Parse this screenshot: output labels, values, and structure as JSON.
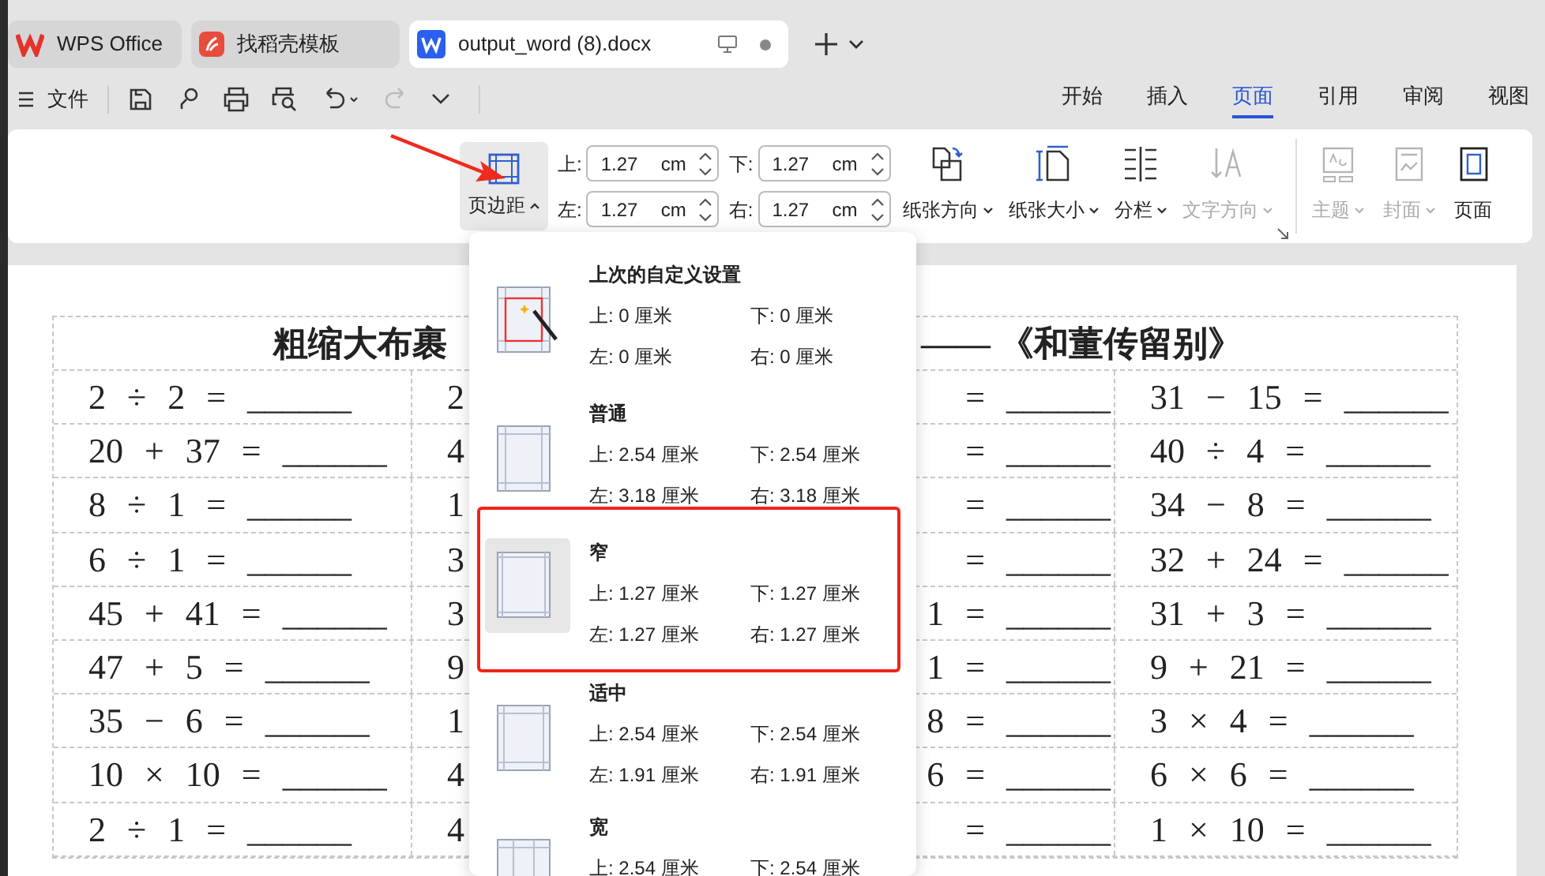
{
  "tabs": [
    {
      "label": "WPS Office",
      "kind": "wps",
      "selected": false
    },
    {
      "label": "找稻壳模板",
      "kind": "docer",
      "selected": false
    },
    {
      "label": "output_word (8).docx",
      "kind": "writer",
      "selected": true
    }
  ],
  "quick_toolbar": {
    "file_label": "文件"
  },
  "ribbon_tabs": [
    {
      "label": "开始",
      "selected": false
    },
    {
      "label": "插入",
      "selected": false
    },
    {
      "label": "页面",
      "selected": true
    },
    {
      "label": "引用",
      "selected": false
    },
    {
      "label": "审阅",
      "selected": false
    },
    {
      "label": "视图",
      "selected": false
    }
  ],
  "ribbon": {
    "margin_button": "页边距",
    "margin_fields": [
      {
        "label": "上:",
        "value": "1.27",
        "unit": "cm"
      },
      {
        "label": "下:",
        "value": "1.27",
        "unit": "cm"
      },
      {
        "label": "左:",
        "value": "1.27",
        "unit": "cm"
      },
      {
        "label": "右:",
        "value": "1.27",
        "unit": "cm"
      }
    ],
    "tools": [
      {
        "label": "纸张方向",
        "kind": "orientation",
        "disabled": false
      },
      {
        "label": "纸张大小",
        "kind": "size",
        "disabled": false
      },
      {
        "label": "分栏",
        "kind": "columns",
        "disabled": false
      },
      {
        "label": "文字方向",
        "kind": "textdir",
        "disabled": true
      }
    ],
    "tools_2": [
      {
        "label": "主题",
        "kind": "theme",
        "disabled": true
      },
      {
        "label": "封面",
        "kind": "cover",
        "disabled": true
      },
      {
        "label": "页面",
        "kind": "page",
        "disabled": false
      }
    ]
  },
  "margin_menu": {
    "presets": [
      {
        "title": "上次的自定义设置",
        "kind": "custom",
        "selected": false,
        "values": [
          "上: 0 厘米",
          "下: 0 厘米",
          "左: 0 厘米",
          "右: 0 厘米"
        ]
      },
      {
        "title": "普通",
        "kind": "normal",
        "selected": false,
        "values": [
          "上: 2.54 厘米",
          "下: 2.54 厘米",
          "左: 3.18 厘米",
          "右: 3.18 厘米"
        ]
      },
      {
        "title": "窄",
        "kind": "narrow",
        "selected": true,
        "values": [
          "上: 1.27 厘米",
          "下: 1.27 厘米",
          "左: 1.27 厘米",
          "右: 1.27 厘米"
        ]
      },
      {
        "title": "适中",
        "kind": "moderate",
        "selected": false,
        "values": [
          "上: 2.54 厘米",
          "下: 2.54 厘米",
          "左: 1.91 厘米",
          "右: 1.91 厘米"
        ]
      },
      {
        "title": "宽",
        "kind": "wide",
        "selected": false,
        "values": [
          "上: 2.54 厘米",
          "下: 2.54 厘米"
        ]
      }
    ]
  },
  "document": {
    "title_left": "粗缩大布裹",
    "title_right": "—— 《和董传留别》",
    "rows": [
      [
        "2 ÷ 2 = ______",
        "2",
        "= ______",
        "31 − 15 = ______"
      ],
      [
        "20 + 37 = ______",
        "4",
        "= ______",
        "40 ÷ 4 = ______"
      ],
      [
        "8 ÷ 1 = ______",
        "1",
        "= ______",
        "34 − 8 = ______"
      ],
      [
        "6 ÷ 1 = ______",
        "3",
        "= ______",
        "32 + 24 = ______"
      ],
      [
        "45 + 41 = ______",
        "3",
        "1 = ______",
        "31 + 3 = ______"
      ],
      [
        "47 + 5 = ______",
        "9",
        "1 = ______",
        "9 + 21 = ______"
      ],
      [
        "35 − 6 = ______",
        "1",
        "8 = ______",
        "3 × 4 = ______"
      ],
      [
        "10 × 10 = ______",
        "4",
        "6 = ______",
        "6 × 6 = ______"
      ],
      [
        "2 ÷ 1 = ______",
        "4",
        "= ______",
        "1 × 10 = ______"
      ]
    ]
  }
}
